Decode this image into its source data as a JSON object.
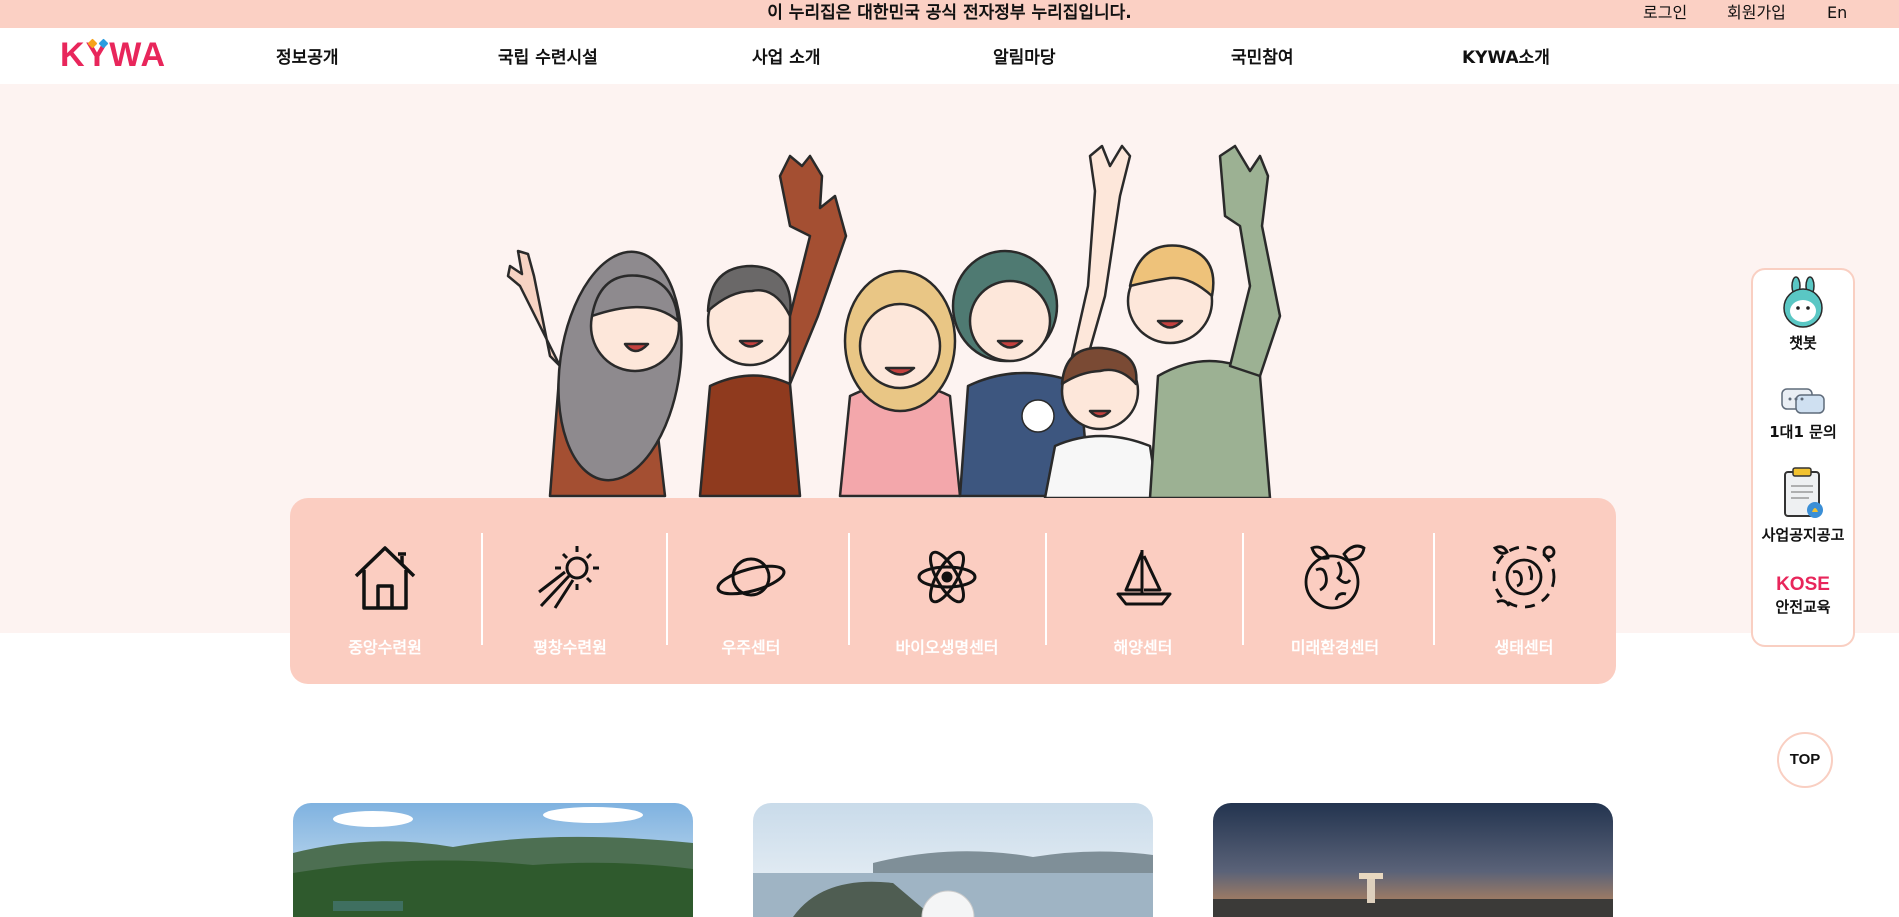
{
  "topbar": {
    "notice": "이 누리집은 대한민국 공식 전자정부 누리집입니다.",
    "login": "로그인",
    "signup": "회원가입",
    "lang": "En"
  },
  "header": {
    "logo_text": "KYWA",
    "nav": [
      "정보공개",
      "국립 수련시설",
      "사업 소개",
      "알림마당",
      "국민참여",
      "KYWA소개"
    ]
  },
  "facilities": [
    {
      "label": "중앙수련원",
      "icon": "house-icon"
    },
    {
      "label": "평창수련원",
      "icon": "sun-icon"
    },
    {
      "label": "우주센터",
      "icon": "planet-icon"
    },
    {
      "label": "바이오생명센터",
      "icon": "atom-icon"
    },
    {
      "label": "해양센터",
      "icon": "sailboat-icon"
    },
    {
      "label": "미래환경센터",
      "icon": "earth-leaf-icon"
    },
    {
      "label": "생태센터",
      "icon": "ecosystem-icon"
    }
  ],
  "quick_menu": {
    "chatbot": "챗봇",
    "inquiry": "1대1 문의",
    "notice": "사업공지공고",
    "safety_brand": "KOSE",
    "safety_label": "안전교육"
  },
  "top_button": "TOP",
  "colors": {
    "topbar_bg": "#fbd0c4",
    "hero_bg": "#fdf3f1",
    "strip_bg": "#fbcdc1",
    "brand": "#e8265b"
  }
}
